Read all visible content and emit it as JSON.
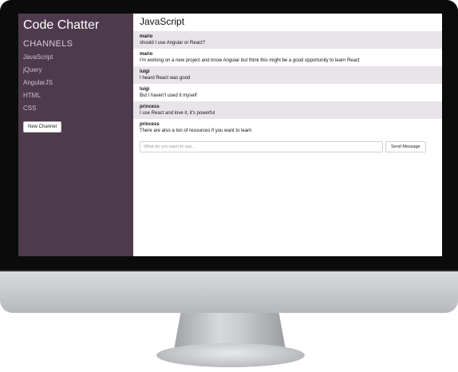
{
  "app": {
    "title": "Code Chatter"
  },
  "sidebar": {
    "heading": "CHANNELS",
    "channels": [
      {
        "label": "JavaScript"
      },
      {
        "label": "jQuery"
      },
      {
        "label": "AngularJS"
      },
      {
        "label": "HTML"
      },
      {
        "label": "CSS"
      }
    ],
    "new_channel_label": "New Channel"
  },
  "main": {
    "channel_title": "JavaScript",
    "messages": [
      {
        "author": "mario",
        "text": "should I use Angular or React?"
      },
      {
        "author": "mario",
        "text": "I'm working on a new project and know Angular but think this might be a good opportunity to learn React"
      },
      {
        "author": "luigi",
        "text": "I heard React was good"
      },
      {
        "author": "luigi",
        "text": "But I haven't used it myself"
      },
      {
        "author": "princess",
        "text": "I use React and love it, it's powerful"
      },
      {
        "author": "princess",
        "text": "There are also a ton of resources if you want to learn"
      }
    ],
    "composer": {
      "placeholder": "What do you want to say...",
      "value": "",
      "send_label": "Send Message"
    }
  },
  "colors": {
    "sidebar_bg": "#4e3a4d",
    "alt_row_bg": "#e9e4e9"
  }
}
